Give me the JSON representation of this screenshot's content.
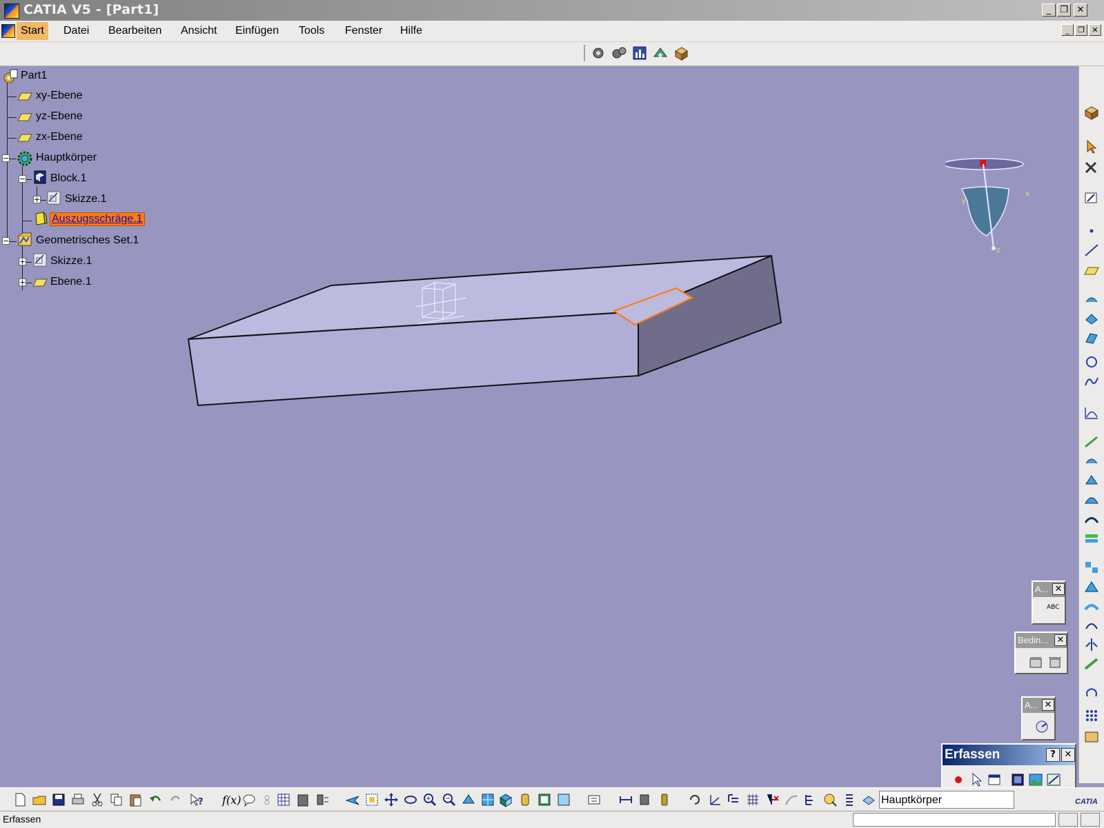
{
  "window": {
    "title": "CATIA V5 - [Part1]",
    "min_label": "_",
    "restore_label": "❐",
    "close_label": "✕"
  },
  "menubar": {
    "items": [
      {
        "label": "Start",
        "active": true
      },
      {
        "label": "Datei"
      },
      {
        "label": "Bearbeiten"
      },
      {
        "label": "Ansicht"
      },
      {
        "label": "Einfügen"
      },
      {
        "label": "Tools"
      },
      {
        "label": "Fenster"
      },
      {
        "label": "Hilfe"
      }
    ]
  },
  "tree": {
    "root": "Part1",
    "items": [
      {
        "label": "xy-Ebene",
        "icon": "plane-icon"
      },
      {
        "label": "yz-Ebene",
        "icon": "plane-icon"
      },
      {
        "label": "zx-Ebene",
        "icon": "plane-icon"
      },
      {
        "label": "Hauptkörper",
        "icon": "body-gear-icon"
      },
      {
        "label": "Block.1",
        "icon": "pad-icon"
      },
      {
        "label": "Skizze.1",
        "icon": "sketch-icon"
      },
      {
        "label": "Auszugsschräge.1",
        "icon": "draft-icon",
        "selected": true
      },
      {
        "label": "Geometrisches Set.1",
        "icon": "geometrical-set-icon"
      },
      {
        "label": "Skizze.1",
        "icon": "sketch-icon"
      },
      {
        "label": "Ebene.1",
        "icon": "plane-icon"
      }
    ]
  },
  "compass": {
    "x_label": "x",
    "y_label": "y",
    "z_label": "z"
  },
  "palettes": {
    "annotation": {
      "title": "A...",
      "close": "✕",
      "icon_text": "ABC"
    },
    "constraints": {
      "title": "Bedin...",
      "close": "✕"
    },
    "analysis": {
      "title": "A...",
      "close": "✕"
    },
    "erfassen": {
      "title": "Erfassen",
      "help": "?",
      "close": "✕"
    }
  },
  "bottom_toolbar": {
    "current_body": "Hauptkörper",
    "formula_label": "f(x)"
  },
  "status": {
    "message": "Erfassen",
    "input_value": ""
  },
  "colors": {
    "viewport_bg": "#9896c0",
    "selection_orange": "#ff7a10",
    "part_top": "#bcbadf",
    "part_front": "#b0aed6",
    "part_side": "#706d8a"
  },
  "logo_text": "CATIA"
}
